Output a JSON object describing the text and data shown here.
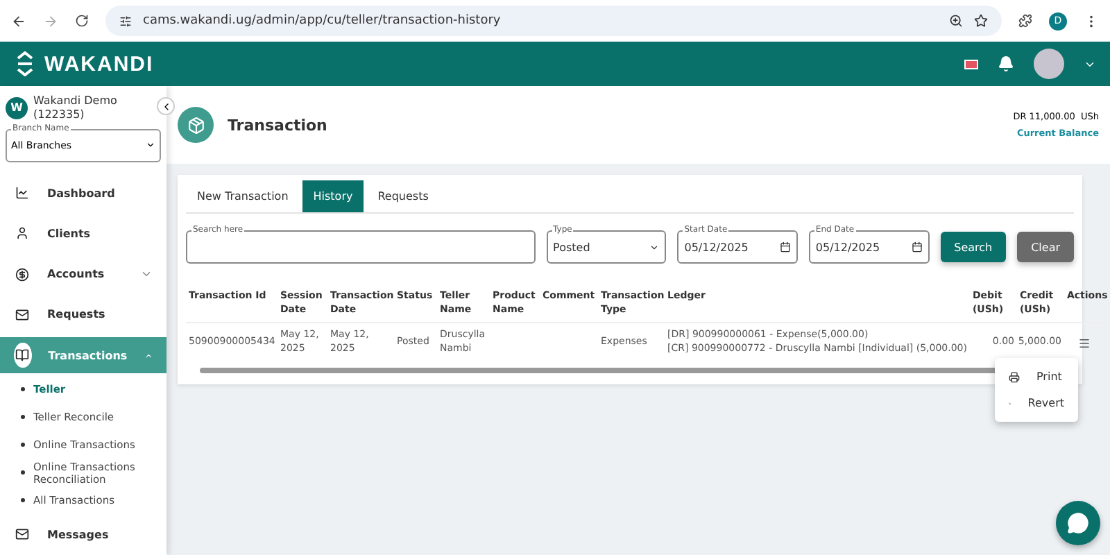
{
  "browser": {
    "url": "cams.wakandi.ug/admin/app/cu/teller/transaction-history",
    "profile_initial": "D"
  },
  "header": {
    "brand": "WAKANDI"
  },
  "sidebar": {
    "org_initial": "W",
    "org_name": "Wakandi Demo",
    "org_code": "(122335)",
    "branch": {
      "label": "Branch Name",
      "value": "All Branches"
    },
    "items": [
      {
        "label": "Dashboard",
        "selected": false
      },
      {
        "label": "Clients",
        "selected": false
      },
      {
        "label": "Accounts",
        "selected": false,
        "expanded": false
      },
      {
        "label": "Requests",
        "selected": false
      },
      {
        "label": "Transactions",
        "selected": true,
        "expanded": true,
        "children": [
          {
            "label": "Teller",
            "selected": true
          },
          {
            "label": "Teller Reconcile",
            "selected": false
          },
          {
            "label": "Online Transactions",
            "selected": false
          },
          {
            "label": "Online Transactions Reconciliation",
            "selected": false
          },
          {
            "label": "All Transactions",
            "selected": false
          }
        ]
      },
      {
        "label": "Messages",
        "selected": false
      }
    ]
  },
  "page": {
    "title": "Transaction",
    "balance": "DR 11,000.00  USh",
    "balance_label": "Current Balance"
  },
  "tabs": [
    {
      "label": "New Transaction",
      "selected": false
    },
    {
      "label": "History",
      "selected": true
    },
    {
      "label": "Requests",
      "selected": false
    }
  ],
  "filters": {
    "search": {
      "label": "Search here"
    },
    "type": {
      "label": "Type",
      "value": "Posted"
    },
    "start": {
      "label": "Start Date",
      "value": "05/12/2025"
    },
    "end": {
      "label": "End Date",
      "value": "05/12/2025"
    },
    "buttons": [
      "Search",
      "Clear"
    ]
  },
  "table": {
    "columns": [
      "Transaction Id",
      "Session Date",
      "Transaction Date",
      "Status",
      "Teller Name",
      "Product Name",
      "Comment",
      "Transaction Type",
      "Ledger",
      "Debit (USh)",
      "Credit (USh)",
      "Actions"
    ],
    "rows": [
      {
        "id": "50900900005434",
        "session_date": "May 12, 2025",
        "transaction_date": "May 12, 2025",
        "status": "Posted",
        "teller": "Druscylla Nambi",
        "type": "Expenses",
        "ledger": [
          "[DR] 900990000061 - Expense(5,000.00)",
          "[CR] 900990000772 - Druscylla Nambi [Individual] (5,000.00)"
        ],
        "debit": "0.00",
        "credit": "5,000.00"
      }
    ]
  },
  "action_menu": [
    {
      "label": "Print"
    },
    {
      "label": "Revert"
    }
  ]
}
